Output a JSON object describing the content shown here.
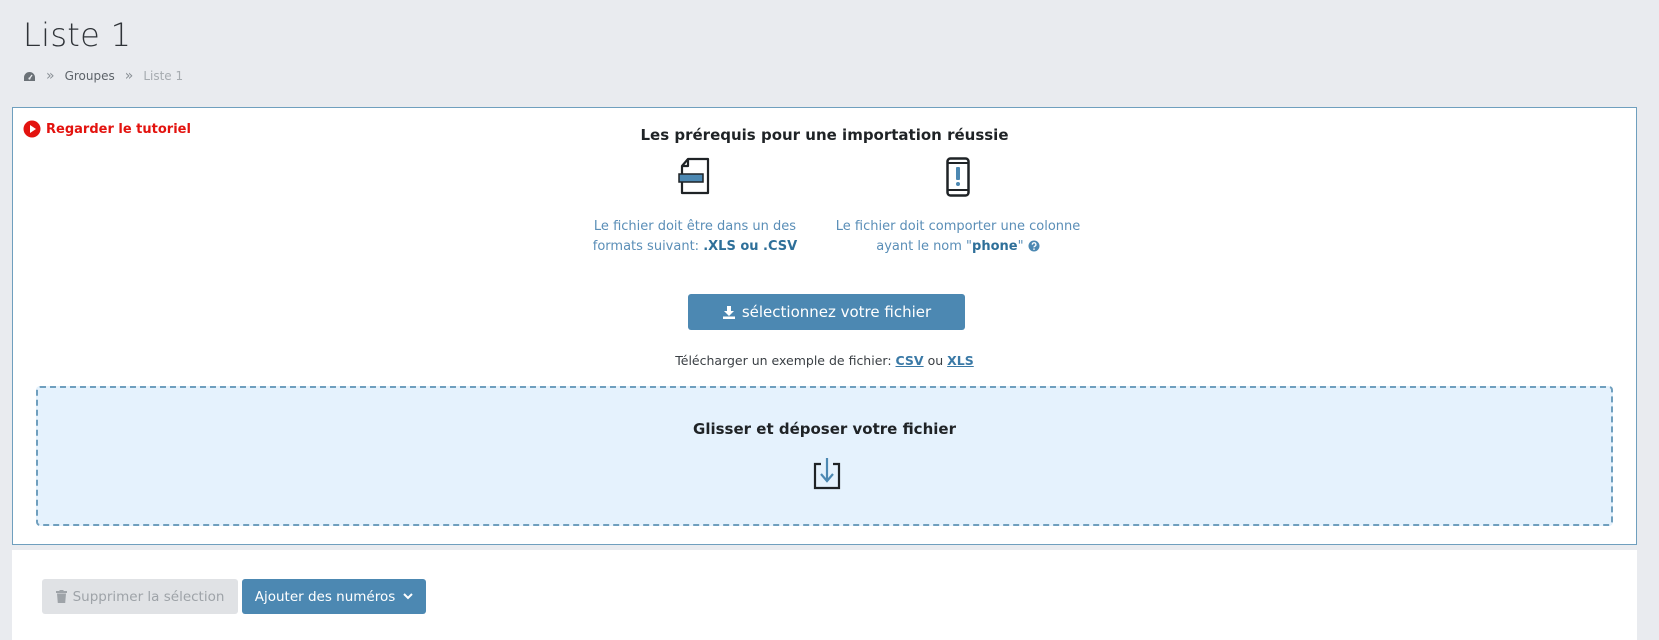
{
  "page": {
    "title": "Liste 1"
  },
  "breadcrumb": {
    "home_icon": "dashboard-icon",
    "separator": "»",
    "items": [
      "Groupes",
      "Liste 1"
    ]
  },
  "import": {
    "tutorial_label": "Regarder le tutoriel",
    "prereq_title": "Les prérequis pour une importation réussie",
    "req1": {
      "icon": "file-icon",
      "text_part1": "Le fichier doit être dans un des formats suivant: ",
      "text_bold": ".XLS ou .CSV"
    },
    "req2": {
      "icon": "phone-alert-icon",
      "text_part1": "Le fichier doit comporter une colonne ayant le nom \"",
      "text_bold": "phone",
      "text_part2": "\" ",
      "help_icon": "question-circle-icon"
    },
    "select_button": "sélectionnez votre fichier",
    "example_prefix": "Télécharger un exemple de fichier: ",
    "example_csv": "CSV",
    "example_or": " ou ",
    "example_xls": "XLS",
    "dropzone_title": "Glisser et déposer votre fichier"
  },
  "actions": {
    "delete_label": "Supprimer la sélection",
    "add_label": "Ajouter des numéros"
  },
  "colors": {
    "accent": "#4c88b2",
    "tutorial_red": "#e3130f",
    "dropzone_bg": "#e5f2fd",
    "border": "#6f9fbe"
  }
}
